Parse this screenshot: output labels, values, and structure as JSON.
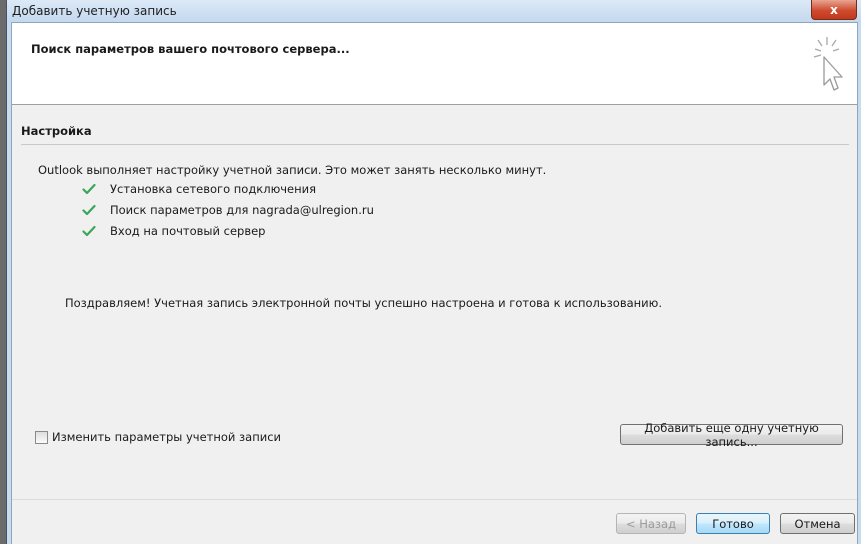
{
  "window": {
    "title": "Добавить учетную запись",
    "close_label": "x"
  },
  "header": {
    "title": "Поиск параметров вашего почтового сервера..."
  },
  "section": {
    "title": "Настройка",
    "intro": "Outlook выполняет настройку учетной записи. Это может занять несколько минут.",
    "steps": [
      {
        "label": "Установка сетевого подключения",
        "status": "done"
      },
      {
        "label": "Поиск параметров для nagrada@ulregion.ru",
        "status": "done"
      },
      {
        "label": "Вход на почтовый сервер",
        "status": "done"
      }
    ],
    "message": "Поздравляем! Учетная запись электронной почты успешно настроена и готова к использованию."
  },
  "options": {
    "change_settings_label": "Изменить параметры учетной записи",
    "change_settings_checked": false,
    "add_another_label": "Добавить еще одну учетную запись..."
  },
  "footer": {
    "back_label": "< Назад",
    "finish_label": "Готово",
    "cancel_label": "Отмена"
  },
  "colors": {
    "check": "#3aa65a",
    "close_button": "#c9452a",
    "accent_border": "#3c7fb1"
  }
}
